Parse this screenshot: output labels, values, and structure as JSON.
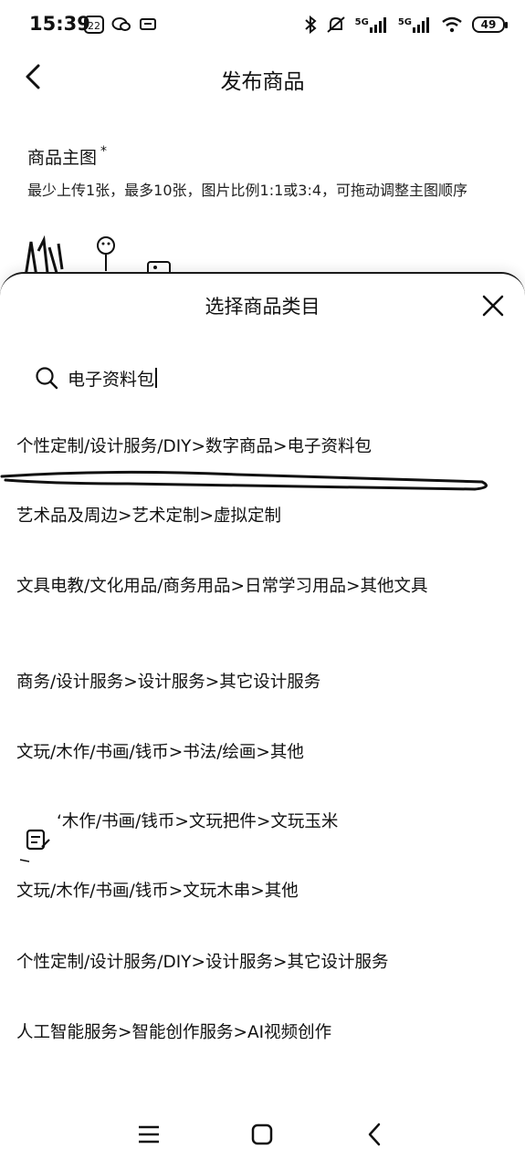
{
  "status_bar": {
    "time": "15:39",
    "left_icons": [
      "calendar-icon",
      "wechat-icon",
      "message-icon"
    ],
    "calendar_day": "22",
    "right_icons": [
      "bluetooth-icon",
      "mute-icon",
      "signal-5g-icon",
      "signal-5g-icon",
      "wifi-icon",
      "battery-icon"
    ],
    "net_label_1": "5G",
    "net_label_2": "5G",
    "battery": "49"
  },
  "header": {
    "title": "发布商品",
    "back_icon": "chevron-left-icon"
  },
  "form": {
    "main_image_label": "商品主图",
    "required_mark": "*",
    "main_image_hint": "最少上传1张，最多10张，图片比例1:1或3:4，可拖动调整主图顺序"
  },
  "sheet": {
    "title": "选择商品类目",
    "close_icon": "close-icon",
    "search": {
      "icon": "search-icon",
      "value": "电子资料包"
    },
    "results": [
      "个性定制/设计服务/DIY>数字商品>电子资料包",
      "艺术品及周边>艺术定制>虚拟定制",
      "文具电教/文化用品/商务用品>日常学习用品>其他文具",
      "商务/设计服务>设计服务>其它设计服务",
      "文玩/木作/书画/钱币>书法/绘画>其他",
      "‘木作/书画/钱币>文玩把件>文玩玉米",
      "文玩/木作/书画/钱币>文玩木串>其他",
      "个性定制/设计服务/DIY>设计服务>其它设计服务",
      "人工智能服务>智能创作服务>AI视频创作"
    ]
  },
  "nav_bar": {
    "icons": [
      "menu-icon",
      "home-icon",
      "back-icon"
    ]
  }
}
